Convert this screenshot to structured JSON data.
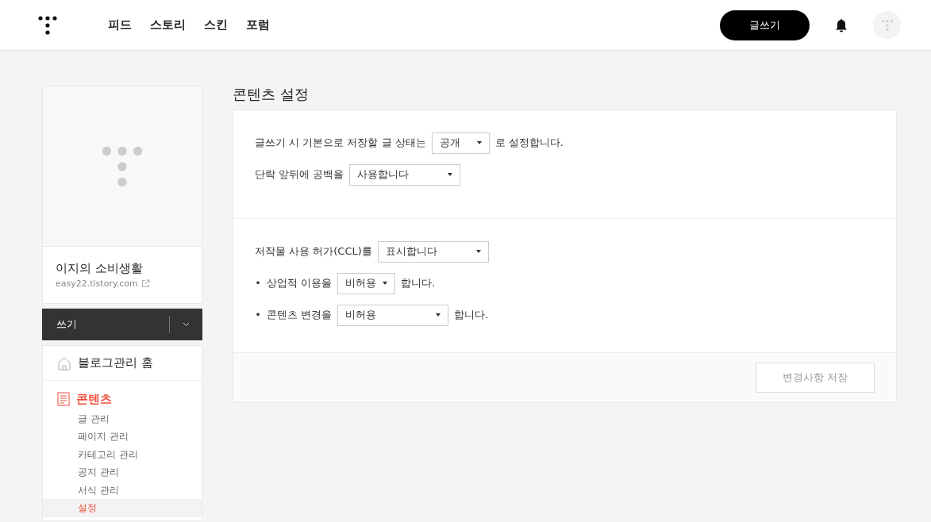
{
  "header": {
    "nav": [
      "피드",
      "스토리",
      "스킨",
      "포럼"
    ],
    "write_button": "글쓰기"
  },
  "sidebar": {
    "blog_name": "이지의 소비생활",
    "blog_url": "easy22.tistory.com",
    "write_bar": "쓰기",
    "menu": [
      {
        "label": "블로그관리 홈",
        "active": false
      },
      {
        "label": "콘텐츠",
        "active": true,
        "children": [
          {
            "label": "글 관리",
            "selected": false
          },
          {
            "label": "페이지 관리",
            "selected": false
          },
          {
            "label": "카테고리 관리",
            "selected": false
          },
          {
            "label": "공지 관리",
            "selected": false
          },
          {
            "label": "서식 관리",
            "selected": false
          },
          {
            "label": "설정",
            "selected": true
          }
        ]
      }
    ]
  },
  "page_title": "콘텐츠 설정",
  "sections": [
    {
      "rows": [
        {
          "bullet": "",
          "label": "글쓰기 시 기본으로 저장할 글 상태는",
          "value": "공개",
          "suffix": "로 설정합니다."
        },
        {
          "bullet": "",
          "label": "단락 앞뒤에 공백을",
          "value": "사용합니다",
          "suffix": ""
        }
      ]
    },
    {
      "rows": [
        {
          "bullet": "",
          "label": "저작물 사용 허가(CCL)를",
          "value": "표시합니다",
          "suffix": ""
        },
        {
          "bullet": "•",
          "label": "상업적 이용을",
          "value": "비허용",
          "suffix": "합니다."
        },
        {
          "bullet": "•",
          "label": "콘텐츠 변경을",
          "value": "비허용",
          "suffix": "합니다."
        }
      ]
    }
  ],
  "save_button": {
    "label": "변경사항 저장",
    "disabled": true
  }
}
